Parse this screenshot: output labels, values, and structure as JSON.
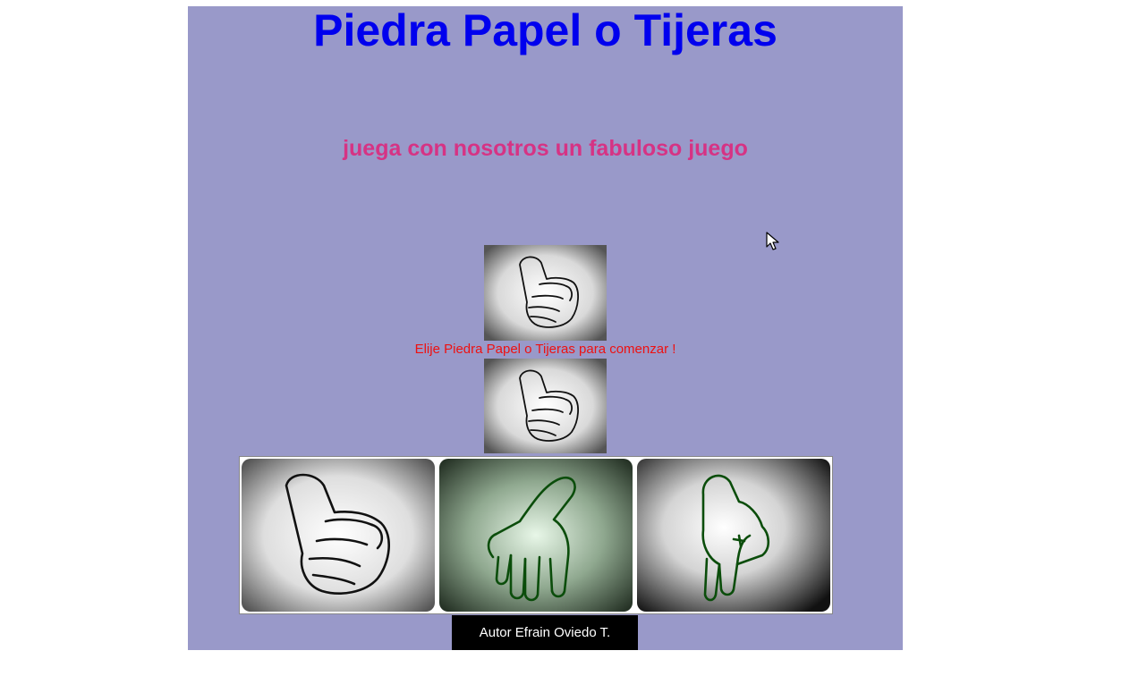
{
  "page": {
    "title": "Piedra Papel o Tijeras",
    "subtitle": "juega con nosotros un fabuloso juego",
    "status": "Elije Piedra Papel o Tijeras para comenzar !",
    "author": "Autor Efrain Oviedo T."
  },
  "choices": {
    "computer": "piedra",
    "player": "piedra"
  },
  "options": [
    {
      "name": "piedra",
      "icon": "fist-icon"
    },
    {
      "name": "papel",
      "icon": "open-hand-icon"
    },
    {
      "name": "tijeras",
      "icon": "scissors-hand-icon"
    }
  ],
  "colors": {
    "panel": "#9999c9",
    "title": "#0000ee",
    "subtitle": "#d63384",
    "status": "#ee1111",
    "footer_bg": "#000000"
  }
}
